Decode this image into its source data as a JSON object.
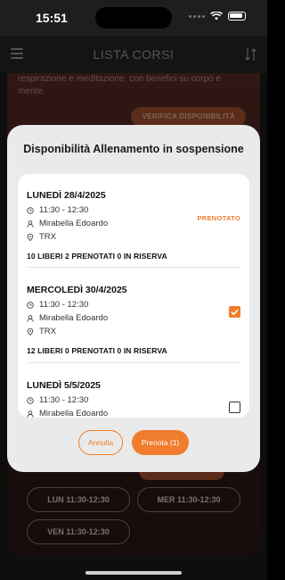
{
  "status_bar": {
    "time": "15:51"
  },
  "header": {
    "title": "LISTA CORSI"
  },
  "background": {
    "description_text": "respirazione e meditazione, con benefici su corpo e mente.",
    "verify_button": "VERIFICA DISPONIBILITÀ",
    "slots": [
      "LUN 11:30-12:30",
      "MER 11:30-12:30",
      "VEN 11:30-12:30"
    ]
  },
  "modal": {
    "title": "Disponibilità Allenamento in sospensione",
    "sessions": [
      {
        "date": "LUNEDÌ 28/4/2025",
        "time": "11:30 - 12:30",
        "instructor": "Mirabella Edoardo",
        "location": "TRX",
        "stats": "10 LIBERI  2 PRENOTATI  0 IN RISERVA",
        "badge": "PRENOTATO"
      },
      {
        "date": "MERCOLEDÌ 30/4/2025",
        "time": "11:30 - 12:30",
        "instructor": "Mirabella Edoardo",
        "location": "TRX",
        "stats": "12 LIBERI  0 PRENOTATI  0 IN RISERVA",
        "selected": true
      },
      {
        "date": "LUNEDÌ 5/5/2025",
        "time": "11:30 - 12:30",
        "instructor": "Mirabella Edoardo",
        "selected": false
      }
    ],
    "cancel_label": "Annulla",
    "book_label": "Prenota (1)"
  },
  "colors": {
    "accent": "#ef7d2d",
    "header_bg": "#262626"
  }
}
